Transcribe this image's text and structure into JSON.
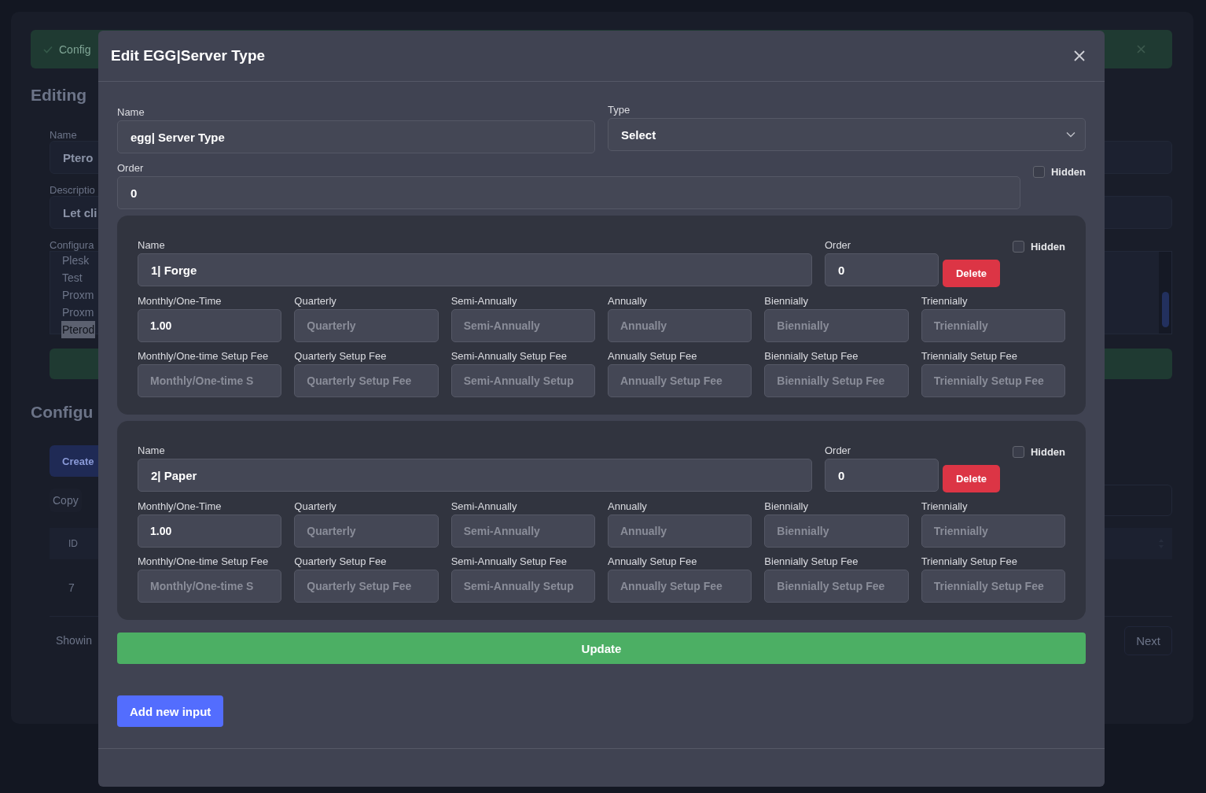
{
  "background": {
    "alert": {
      "text": "Config"
    },
    "heading": "Editing",
    "fields": [
      {
        "label": "Name",
        "value": "Ptero"
      },
      {
        "label": "Descriptio",
        "value": "Let cli"
      }
    ],
    "list": {
      "label": "Configura",
      "items": [
        {
          "text": "Plesk",
          "selected": false
        },
        {
          "text": "Test",
          "selected": false
        },
        {
          "text": "Proxm",
          "selected": false
        },
        {
          "text": "Proxm",
          "selected": false
        },
        {
          "text": "Pterod",
          "selected": true
        }
      ]
    },
    "heading2": "Configu",
    "create": "Create",
    "copy": "Copy",
    "table": {
      "columns": [
        "ID"
      ],
      "rows": [
        [
          "7"
        ]
      ]
    },
    "footer": "Showin",
    "next": "Next"
  },
  "modal": {
    "title": "Edit EGG|Server Type",
    "name": {
      "label": "Name",
      "value": "egg| Server Type"
    },
    "type": {
      "label": "Type",
      "value": "Select"
    },
    "order": {
      "label": "Order",
      "value": "0"
    },
    "hidden": {
      "label": "Hidden",
      "checked": false
    },
    "options": [
      {
        "name": {
          "label": "Name",
          "value": "1| Forge"
        },
        "order": {
          "label": "Order",
          "value": "0"
        },
        "delete": "Delete",
        "hidden": {
          "label": "Hidden",
          "checked": false
        },
        "prices": [
          {
            "label": "Monthly/One-Time",
            "value": "1.00"
          },
          {
            "label": "Quarterly",
            "placeholder": "Quarterly"
          },
          {
            "label": "Semi-Annually",
            "placeholder": "Semi-Annually"
          },
          {
            "label": "Annually",
            "placeholder": "Annually"
          },
          {
            "label": "Biennially",
            "placeholder": "Biennially"
          },
          {
            "label": "Triennially",
            "placeholder": "Triennially"
          }
        ],
        "setup_fees": [
          {
            "label": "Monthly/One-time Setup Fee",
            "placeholder": "Monthly/One-time S"
          },
          {
            "label": "Quarterly Setup Fee",
            "placeholder": "Quarterly Setup Fee"
          },
          {
            "label": "Semi-Annually Setup Fee",
            "placeholder": "Semi-Annually Setup"
          },
          {
            "label": "Annually Setup Fee",
            "placeholder": "Annually Setup Fee"
          },
          {
            "label": "Biennially Setup Fee",
            "placeholder": "Biennially Setup Fee"
          },
          {
            "label": "Triennially Setup Fee",
            "placeholder": "Triennially Setup Fee"
          }
        ]
      },
      {
        "name": {
          "label": "Name",
          "value": "2| Paper"
        },
        "order": {
          "label": "Order",
          "value": "0"
        },
        "delete": "Delete",
        "hidden": {
          "label": "Hidden",
          "checked": false
        },
        "prices": [
          {
            "label": "Monthly/One-Time",
            "value": "1.00"
          },
          {
            "label": "Quarterly",
            "placeholder": "Quarterly"
          },
          {
            "label": "Semi-Annually",
            "placeholder": "Semi-Annually"
          },
          {
            "label": "Annually",
            "placeholder": "Annually"
          },
          {
            "label": "Biennially",
            "placeholder": "Biennially"
          },
          {
            "label": "Triennially",
            "placeholder": "Triennially"
          }
        ],
        "setup_fees": [
          {
            "label": "Monthly/One-time Setup Fee",
            "placeholder": "Monthly/One-time S"
          },
          {
            "label": "Quarterly Setup Fee",
            "placeholder": "Quarterly Setup Fee"
          },
          {
            "label": "Semi-Annually Setup Fee",
            "placeholder": "Semi-Annually Setup"
          },
          {
            "label": "Annually Setup Fee",
            "placeholder": "Annually Setup Fee"
          },
          {
            "label": "Biennially Setup Fee",
            "placeholder": "Biennially Setup Fee"
          },
          {
            "label": "Triennially Setup Fee",
            "placeholder": "Triennially Setup Fee"
          }
        ]
      }
    ],
    "update": "Update",
    "add": "Add new input"
  }
}
